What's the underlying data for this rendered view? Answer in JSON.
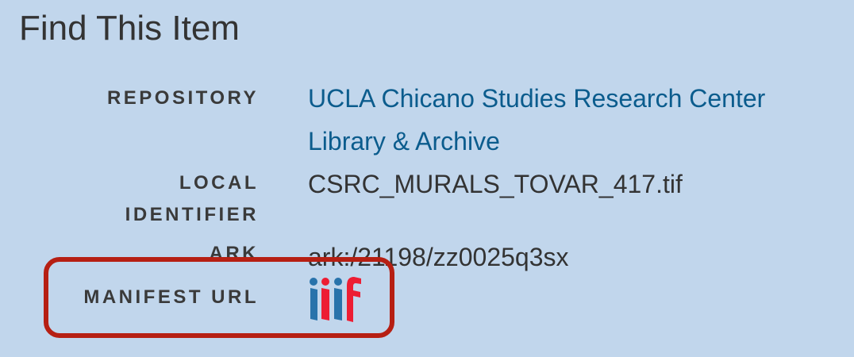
{
  "section": {
    "title": "Find This Item"
  },
  "fields": {
    "repository": {
      "label": "REPOSITORY",
      "value": "UCLA Chicano Studies Research Center Library & Archive"
    },
    "local_identifier": {
      "label": "LOCAL IDENTIFIER",
      "value": "CSRC_MURALS_TOVAR_417.tif"
    },
    "ark": {
      "label": "ARK",
      "value": "ark:/21198/zz0025q3sx"
    },
    "manifest_url": {
      "label": "MANIFEST URL",
      "icon": "iiif-logo-icon",
      "logo_text": "iiif"
    }
  },
  "colors": {
    "background": "#c1d6ec",
    "link": "#0b5c8d",
    "highlight_border": "#b61f13",
    "iiif_blue": "#2873ab",
    "iiif_red": "#ed1d33"
  }
}
